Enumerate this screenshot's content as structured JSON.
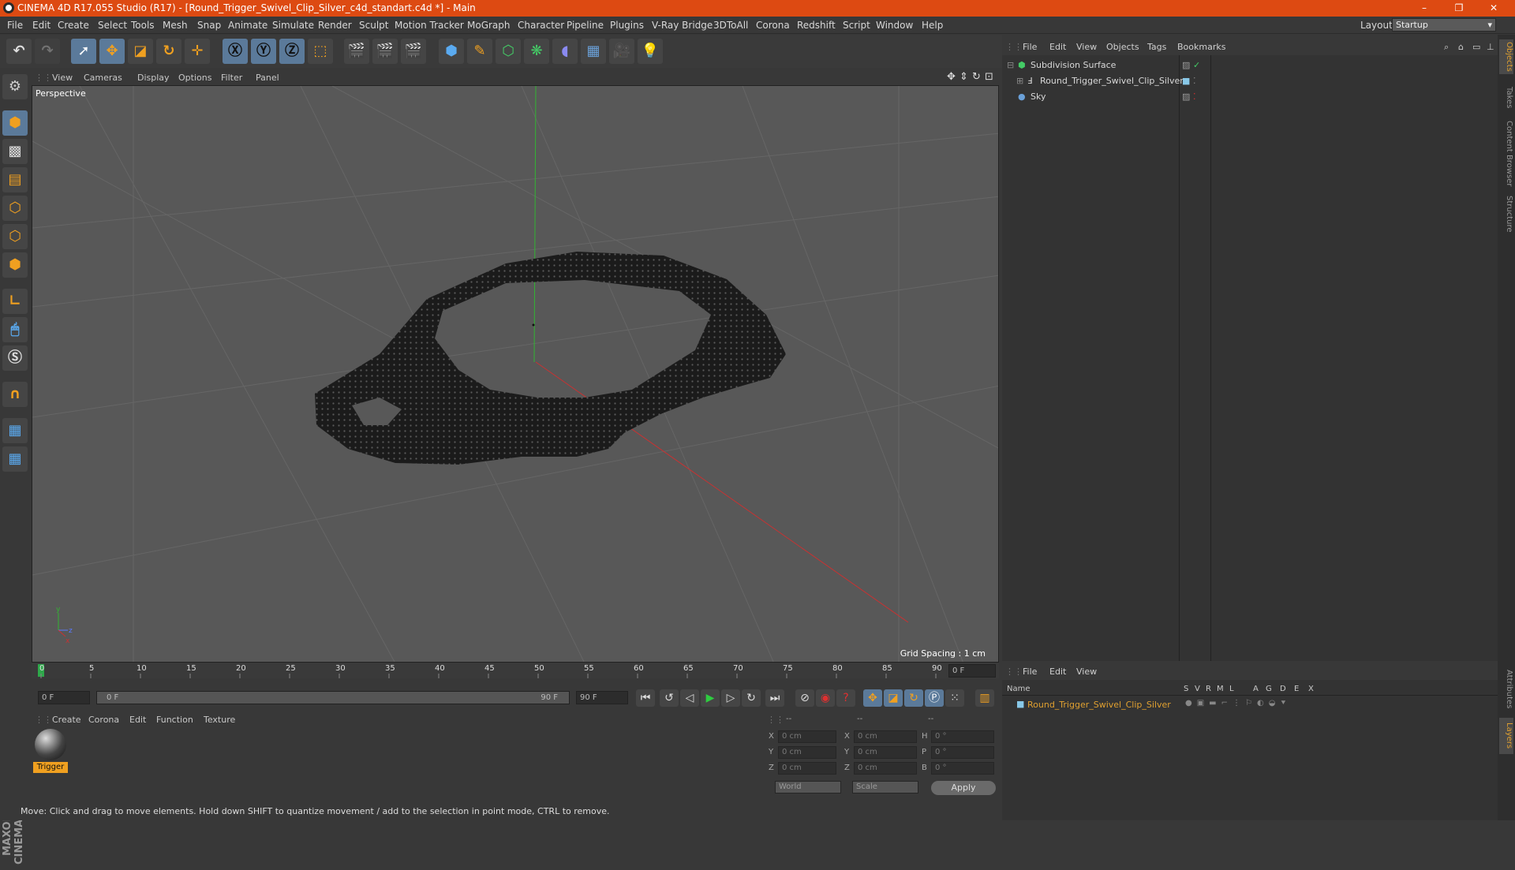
{
  "window": {
    "title": "CINEMA 4D R17.055 Studio (R17) - [Round_Trigger_Swivel_Clip_Silver_c4d_standart.c4d *] - Main",
    "minimize": "–",
    "restore": "❐",
    "close": "✕"
  },
  "menu": [
    "File",
    "Edit",
    "Create",
    "Select",
    "Tools",
    "Mesh",
    "Snap",
    "Animate",
    "Simulate",
    "Render",
    "Sculpt",
    "Motion Tracker",
    "MoGraph",
    "Character",
    "Pipeline",
    "Plugins",
    "V-Ray Bridge",
    "3DToAll",
    "Corona",
    "Redshift",
    "Script",
    "Window",
    "Help"
  ],
  "layout": {
    "label": "Layout:",
    "value": "Startup"
  },
  "viewport": {
    "menu": [
      "View",
      "Cameras",
      "Display",
      "Options",
      "Filter",
      "Panel"
    ],
    "label": "Perspective",
    "grid_spacing": "Grid Spacing : 1 cm"
  },
  "timeline": {
    "ticks": [
      "0",
      "5",
      "10",
      "15",
      "20",
      "25",
      "30",
      "35",
      "40",
      "45",
      "50",
      "55",
      "60",
      "65",
      "70",
      "75",
      "80",
      "85",
      "90"
    ],
    "current_frame": "0 F",
    "start": "0 F",
    "range_start": "0 F",
    "range_end": "90 F",
    "end": "90 F"
  },
  "material_panel": {
    "menu": [
      "Create",
      "Corona",
      "Edit",
      "Function",
      "Texture"
    ],
    "materials": [
      {
        "name": "Trigger"
      }
    ]
  },
  "coords": {
    "headers": [
      "--",
      "--",
      "--"
    ],
    "rows": [
      {
        "a": "X",
        "av": "0 cm",
        "b": "X",
        "bv": "0 cm",
        "c": "H",
        "cv": "0 °"
      },
      {
        "a": "Y",
        "av": "0 cm",
        "b": "Y",
        "bv": "0 cm",
        "c": "P",
        "cv": "0 °"
      },
      {
        "a": "Z",
        "av": "0 cm",
        "b": "Z",
        "bv": "0 cm",
        "c": "B",
        "cv": "0 °"
      }
    ],
    "space": "World",
    "mode": "Scale",
    "apply": "Apply"
  },
  "status": "Move: Click and drag to move elements. Hold down SHIFT to quantize movement / add to the selection in point mode, CTRL to remove.",
  "object_manager": {
    "menu": [
      "File",
      "Edit",
      "View",
      "Objects",
      "Tags",
      "Bookmarks"
    ],
    "objects": [
      {
        "name": "Subdivision Surface",
        "color": "#44cc66"
      },
      {
        "name": "Round_Trigger_Swivel_Clip_Silver",
        "color": "#88c8e8"
      },
      {
        "name": "Sky",
        "color": "#6aa0d8"
      }
    ]
  },
  "layer_manager": {
    "menu": [
      "File",
      "Edit",
      "View"
    ],
    "columns": [
      "Name",
      "S",
      "V",
      "R",
      "M",
      "L",
      "A",
      "G",
      "D",
      "E",
      "X"
    ],
    "layers": [
      {
        "name": "Round_Trigger_Swivel_Clip_Silver",
        "color": "#88c8e8"
      }
    ]
  },
  "side_tabs": [
    "Objects",
    "Takes",
    "Content Browser",
    "Structure"
  ],
  "side_tabs_bottom": [
    "Attributes",
    "Layers"
  ],
  "colors": {
    "title_bar": "#dd4a12",
    "accent": "#e0a030",
    "axis_x": "#c83232",
    "axis_y": "#32b432"
  }
}
